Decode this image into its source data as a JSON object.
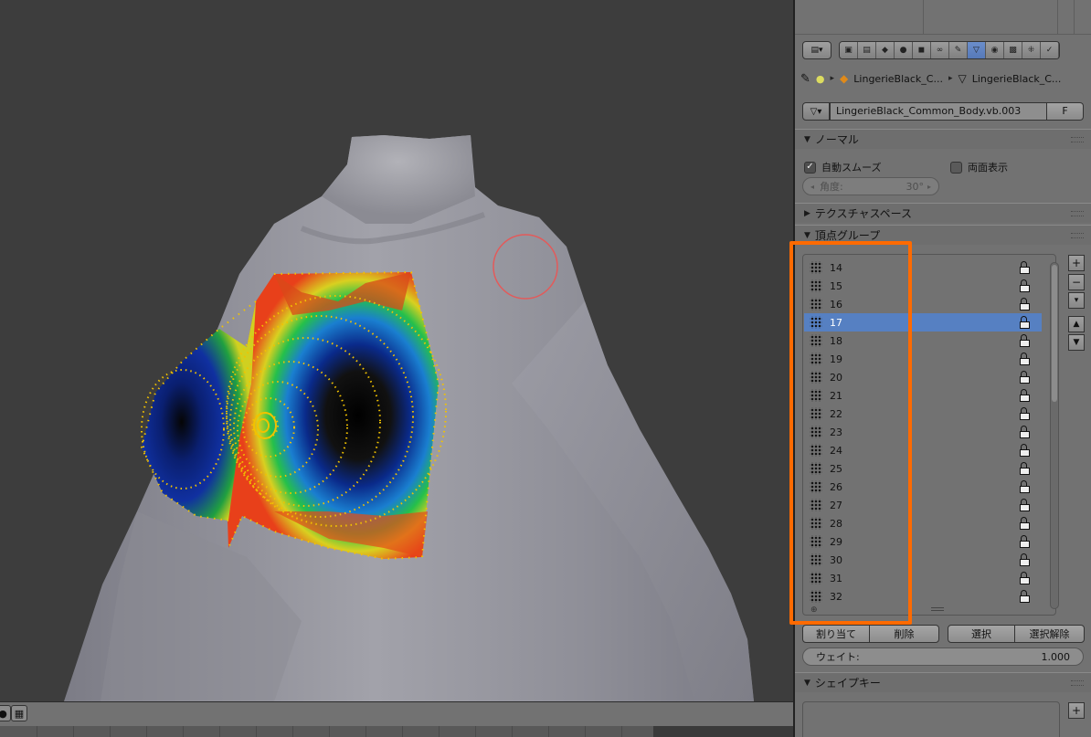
{
  "breadcrumb": {
    "object_name": "LingerieBlack_C...",
    "mesh_name": "LingerieBlack_C..."
  },
  "mesh_field": {
    "name": "LingerieBlack_Common_Body.vb.003",
    "fake_user": "F"
  },
  "normals_panel": {
    "title": "ノーマル",
    "auto_smooth_label": "自動スムーズ",
    "double_sided_label": "両面表示",
    "angle_label": "角度:",
    "angle_value": "30°"
  },
  "texture_space_panel": {
    "title": "テクスチャスペース"
  },
  "vertex_groups_panel": {
    "title": "頂点グループ",
    "items": [
      "14",
      "15",
      "16",
      "17",
      "18",
      "19",
      "20",
      "21",
      "22",
      "23",
      "24",
      "25",
      "26",
      "27",
      "28",
      "29",
      "30",
      "31",
      "32"
    ],
    "active": "17",
    "assign_label": "割り当て",
    "remove_label": "削除",
    "select_label": "選択",
    "deselect_label": "選択解除",
    "weight_label": "ウェイト:",
    "weight_value": "1.000"
  },
  "shape_keys_panel": {
    "title": "シェイプキー"
  },
  "colors": {
    "highlight": "#ff6a00",
    "active_row": "#5680c2",
    "panel_bg": "#727272",
    "viewport_bg": "#3d3d3d"
  },
  "icons": {
    "pin": "pin-icon",
    "lock": "lock-icon",
    "vertex_group": "vertex-group-icon",
    "mesh": "mesh-data-icon",
    "object": "object-cube-icon"
  }
}
